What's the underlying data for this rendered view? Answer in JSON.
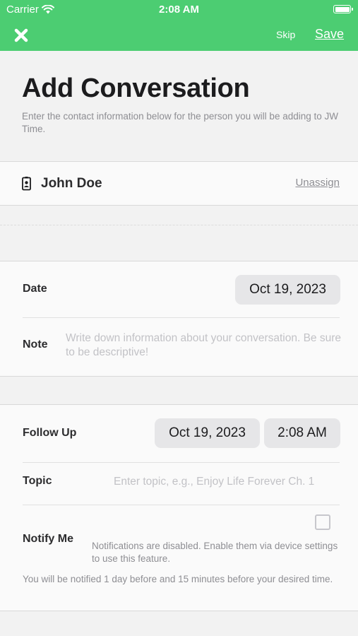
{
  "status_bar": {
    "carrier": "Carrier",
    "time": "2:08 AM"
  },
  "nav": {
    "skip_label": "Skip",
    "save_label": "Save"
  },
  "header": {
    "title": "Add Conversation",
    "subtitle": "Enter the contact information below for the person you will be adding to JW Time."
  },
  "contact": {
    "name": "John Doe",
    "unassign_label": "Unassign"
  },
  "conversation": {
    "date_label": "Date",
    "date_value": "Oct 19, 2023",
    "note_label": "Note",
    "note_placeholder": "Write down information about your conversation. Be sure to be descriptive!"
  },
  "follow_up": {
    "label": "Follow Up",
    "date_value": "Oct 19, 2023",
    "time_value": "2:08 AM",
    "topic_label": "Topic",
    "topic_placeholder": "Enter topic, e.g., Enjoy Life Forever Ch. 1",
    "notify_label": "Notify Me",
    "notify_checked": false,
    "notify_disabled_note": "Notifications are disabled. Enable them via device settings to use this feature.",
    "notify_footnote": "You will be notified 1 day before and 15 minutes before your desired time."
  },
  "colors": {
    "accent": "#4ccd72",
    "background": "#f2f2f2",
    "panel": "#fafafa",
    "pill": "#e6e6e8"
  }
}
